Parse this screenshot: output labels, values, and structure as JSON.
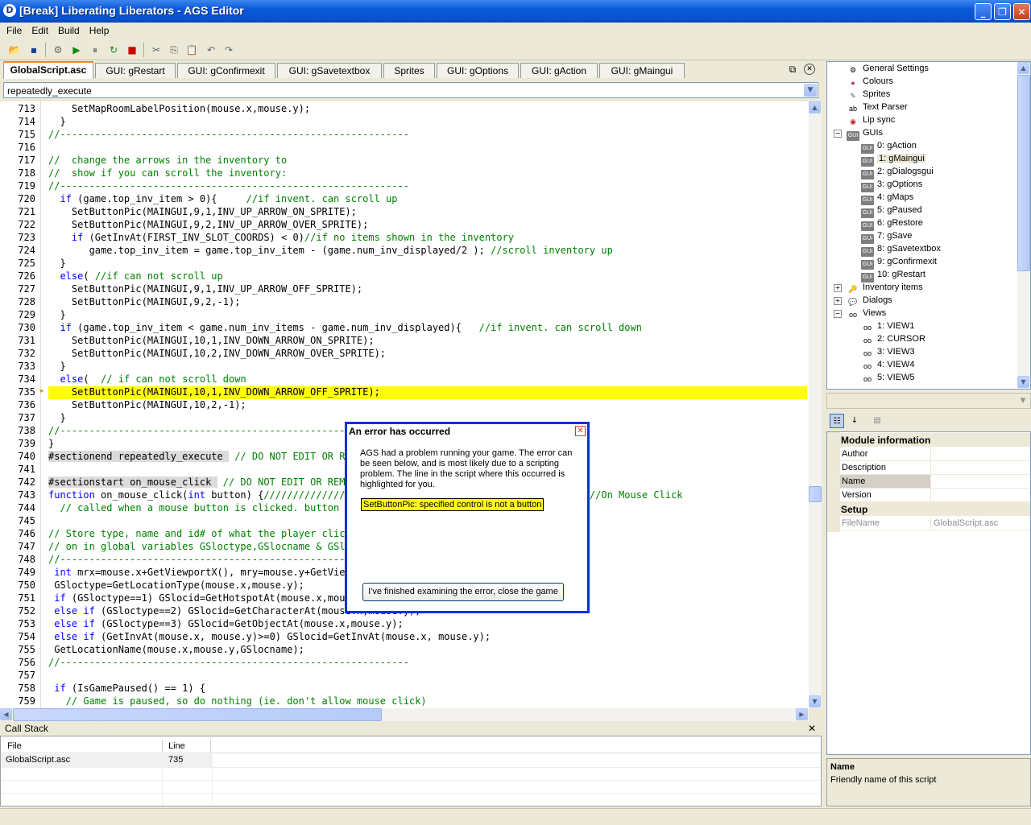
{
  "window": {
    "title": "[Break] Liberating Liberators - AGS Editor",
    "app_icon": "ags-icon",
    "controls": [
      "minimize",
      "maximize",
      "close"
    ]
  },
  "menu": [
    "File",
    "Edit",
    "Build",
    "Help"
  ],
  "toolbar": [
    "open-icon",
    "save-icon",
    "run-debug-icon",
    "play-icon",
    "pause-icon",
    "step-icon",
    "stop-icon",
    "cut-icon",
    "copy-icon",
    "paste-icon",
    "undo-icon",
    "redo-icon"
  ],
  "tabs": [
    {
      "label": "GlobalScript.asc",
      "active": true
    },
    {
      "label": "GUI: gRestart"
    },
    {
      "label": "GUI: gConfirmexit"
    },
    {
      "label": "GUI: gSavetextbox"
    },
    {
      "label": "Sprites"
    },
    {
      "label": "GUI: gOptions"
    },
    {
      "label": "GUI: gAction"
    },
    {
      "label": "GUI: gMaingui"
    }
  ],
  "function_dropdown": "repeatedly_execute",
  "editor": {
    "highlight_line": "735",
    "lines": [
      {
        "n": "713",
        "t": "    SetMapRoomLabelPosition(mouse.x,mouse.y);"
      },
      {
        "n": "714",
        "t": "  }"
      },
      {
        "n": "715",
        "t": "//------------------------------------------------------------"
      },
      {
        "n": "716",
        "t": ""
      },
      {
        "n": "717",
        "t": "//  change the arrows in the inventory to"
      },
      {
        "n": "718",
        "t": "//  show if you can scroll the inventory:"
      },
      {
        "n": "719",
        "t": "//------------------------------------------------------------"
      },
      {
        "n": "720",
        "t": "  if (game.top_inv_item > 0){     //if invent. can scroll up"
      },
      {
        "n": "721",
        "t": "    SetButtonPic(MAINGUI,9,1,INV_UP_ARROW_ON_SPRITE);"
      },
      {
        "n": "722",
        "t": "    SetButtonPic(MAINGUI,9,2,INV_UP_ARROW_OVER_SPRITE);"
      },
      {
        "n": "723",
        "t": "    if (GetInvAt(FIRST_INV_SLOT_COORDS) < 0)//if no items shown in the inventory"
      },
      {
        "n": "724",
        "t": "       game.top_inv_item = game.top_inv_item - (game.num_inv_displayed/2 ); //scroll inventory up"
      },
      {
        "n": "725",
        "t": "  }"
      },
      {
        "n": "726",
        "t": "  else( //if can not scroll up"
      },
      {
        "n": "727",
        "t": "    SetButtonPic(MAINGUI,9,1,INV_UP_ARROW_OFF_SPRITE);"
      },
      {
        "n": "728",
        "t": "    SetButtonPic(MAINGUI,9,2,-1);"
      },
      {
        "n": "729",
        "t": "  }"
      },
      {
        "n": "730",
        "t": "  if (game.top_inv_item < game.num_inv_items - game.num_inv_displayed){   //if invent. can scroll down"
      },
      {
        "n": "731",
        "t": "    SetButtonPic(MAINGUI,10,1,INV_DOWN_ARROW_ON_SPRITE);"
      },
      {
        "n": "732",
        "t": "    SetButtonPic(MAINGUI,10,2,INV_DOWN_ARROW_OVER_SPRITE);"
      },
      {
        "n": "733",
        "t": "  }"
      },
      {
        "n": "734",
        "t": "  else(  // if can not scroll down"
      },
      {
        "n": "735",
        "t": "    SetButtonPic(MAINGUI,10,1,INV_DOWN_ARROW_OFF_SPRITE);"
      },
      {
        "n": "736",
        "t": "    SetButtonPic(MAINGUI,10,2,-1);"
      },
      {
        "n": "737",
        "t": "  }"
      },
      {
        "n": "738",
        "t": "//------------------------------------------------------------"
      },
      {
        "n": "739",
        "t": "}"
      },
      {
        "n": "740",
        "t": "#sectionend repeatedly_execute  // DO NOT EDIT OR REMOVE THIS LINE"
      },
      {
        "n": "741",
        "t": ""
      },
      {
        "n": "742",
        "t": "#sectionstart on_mouse_click  // DO NOT EDIT OR REMOVE THIS LINE"
      },
      {
        "n": "743",
        "t": "function on_mouse_click(int button) {/////////////////////////////On Mouse Click///////////////On Mouse Click"
      },
      {
        "n": "744",
        "t": "  // called when a mouse button is clicked. button is either LEFT or RIGHT"
      },
      {
        "n": "745",
        "t": ""
      },
      {
        "n": "746",
        "t": "// Store type, name and id# of what the player clicked"
      },
      {
        "n": "747",
        "t": "// on in global variables GSloctype,GSlocname & GSlocid:"
      },
      {
        "n": "748",
        "t": "//------------------------------------------------------------"
      },
      {
        "n": "749",
        "t": " int mrx=mouse.x+GetViewportX(), mry=mouse.y+GetViewportY();"
      },
      {
        "n": "750",
        "t": " GSloctype=GetLocationType(mouse.x,mouse.y);"
      },
      {
        "n": "751",
        "t": " if (GSloctype==1) GSlocid=GetHotspotAt(mouse.x,mouse.y);"
      },
      {
        "n": "752",
        "t": " else if (GSloctype==2) GSlocid=GetCharacterAt(mouse.x,mouse.y);"
      },
      {
        "n": "753",
        "t": " else if (GSloctype==3) GSlocid=GetObjectAt(mouse.x,mouse.y);"
      },
      {
        "n": "754",
        "t": " else if (GetInvAt(mouse.x, mouse.y)>=0) GSlocid=GetInvAt(mouse.x, mouse.y);"
      },
      {
        "n": "755",
        "t": " GetLocationName(mouse.x,mouse.y,GSlocname);"
      },
      {
        "n": "756",
        "t": "//------------------------------------------------------------"
      },
      {
        "n": "757",
        "t": ""
      },
      {
        "n": "758",
        "t": " if (IsGamePaused() == 1) {"
      },
      {
        "n": "759",
        "t": "   // Game is paused, so do nothing (ie. don't allow mouse click)"
      }
    ]
  },
  "call_stack": {
    "title": "Call Stack",
    "columns": [
      "File",
      "Line"
    ],
    "rows": [
      {
        "file": "GlobalScript.asc",
        "line": "735"
      }
    ]
  },
  "project_tree": [
    {
      "label": "General Settings",
      "icon": "settings-icon",
      "level": 1
    },
    {
      "label": "Colours",
      "icon": "palette-icon",
      "level": 1
    },
    {
      "label": "Sprites",
      "icon": "sprites-icon",
      "level": 1
    },
    {
      "label": "Text Parser",
      "icon": "text-parser-icon",
      "level": 1
    },
    {
      "label": "Lip sync",
      "icon": "lips-icon",
      "level": 1
    },
    {
      "label": "GUIs",
      "icon": "gui-icon",
      "level": 1,
      "expander": "−"
    },
    {
      "label": "0: gAction",
      "icon": "gui-icon",
      "level": 2
    },
    {
      "label": "1: gMaingui",
      "icon": "gui-icon",
      "level": 2,
      "selected": true
    },
    {
      "label": "2: gDialogsgui",
      "icon": "gui-icon",
      "level": 2
    },
    {
      "label": "3: gOptions",
      "icon": "gui-icon",
      "level": 2
    },
    {
      "label": "4: gMaps",
      "icon": "gui-icon",
      "level": 2
    },
    {
      "label": "5: gPaused",
      "icon": "gui-icon",
      "level": 2
    },
    {
      "label": "6: gRestore",
      "icon": "gui-icon",
      "level": 2
    },
    {
      "label": "7: gSave",
      "icon": "gui-icon",
      "level": 2
    },
    {
      "label": "8: gSavetextbox",
      "icon": "gui-icon",
      "level": 2
    },
    {
      "label": "9: gConfirmexit",
      "icon": "gui-icon",
      "level": 2
    },
    {
      "label": "10: gRestart",
      "icon": "gui-icon",
      "level": 2
    },
    {
      "label": "Inventory items",
      "icon": "inventory-icon",
      "level": 1,
      "expander": "+"
    },
    {
      "label": "Dialogs",
      "icon": "dialog-icon",
      "level": 1,
      "expander": "+"
    },
    {
      "label": "Views",
      "icon": "views-icon",
      "level": 1,
      "expander": "−"
    },
    {
      "label": "1: VIEW1",
      "icon": "view-icon",
      "level": 2
    },
    {
      "label": "2: CURSOR",
      "icon": "view-icon",
      "level": 2
    },
    {
      "label": "3: VIEW3",
      "icon": "view-icon",
      "level": 2
    },
    {
      "label": "4: VIEW4",
      "icon": "view-icon",
      "level": 2
    },
    {
      "label": "5: VIEW5",
      "icon": "view-icon",
      "level": 2
    }
  ],
  "properties": {
    "categories": [
      {
        "name": "Module information",
        "rows": [
          {
            "key": "Author",
            "value": ""
          },
          {
            "key": "Description",
            "value": ""
          },
          {
            "key": "Name",
            "value": "",
            "selected": true
          },
          {
            "key": "Version",
            "value": ""
          }
        ]
      },
      {
        "name": "Setup",
        "rows": [
          {
            "key": "FileName",
            "value": "GlobalScript.asc",
            "disabled": true
          }
        ]
      }
    ],
    "description_title": "Name",
    "description_text": "Friendly name of this script"
  },
  "error_dialog": {
    "title": "An error has occurred",
    "message": "AGS had a problem running your game. The error can be seen below, and is most likely due to a scripting problem. The line in the script where this occurred is highlighted for you.",
    "error": "SetButtonPic: specified control is not a button",
    "button": "I've finished examining the error, close the game"
  },
  "colors": {
    "highlight": "#ffff00",
    "keyword": "#0000ff",
    "comment": "#008000",
    "title_bar": "#0a5ad8"
  }
}
